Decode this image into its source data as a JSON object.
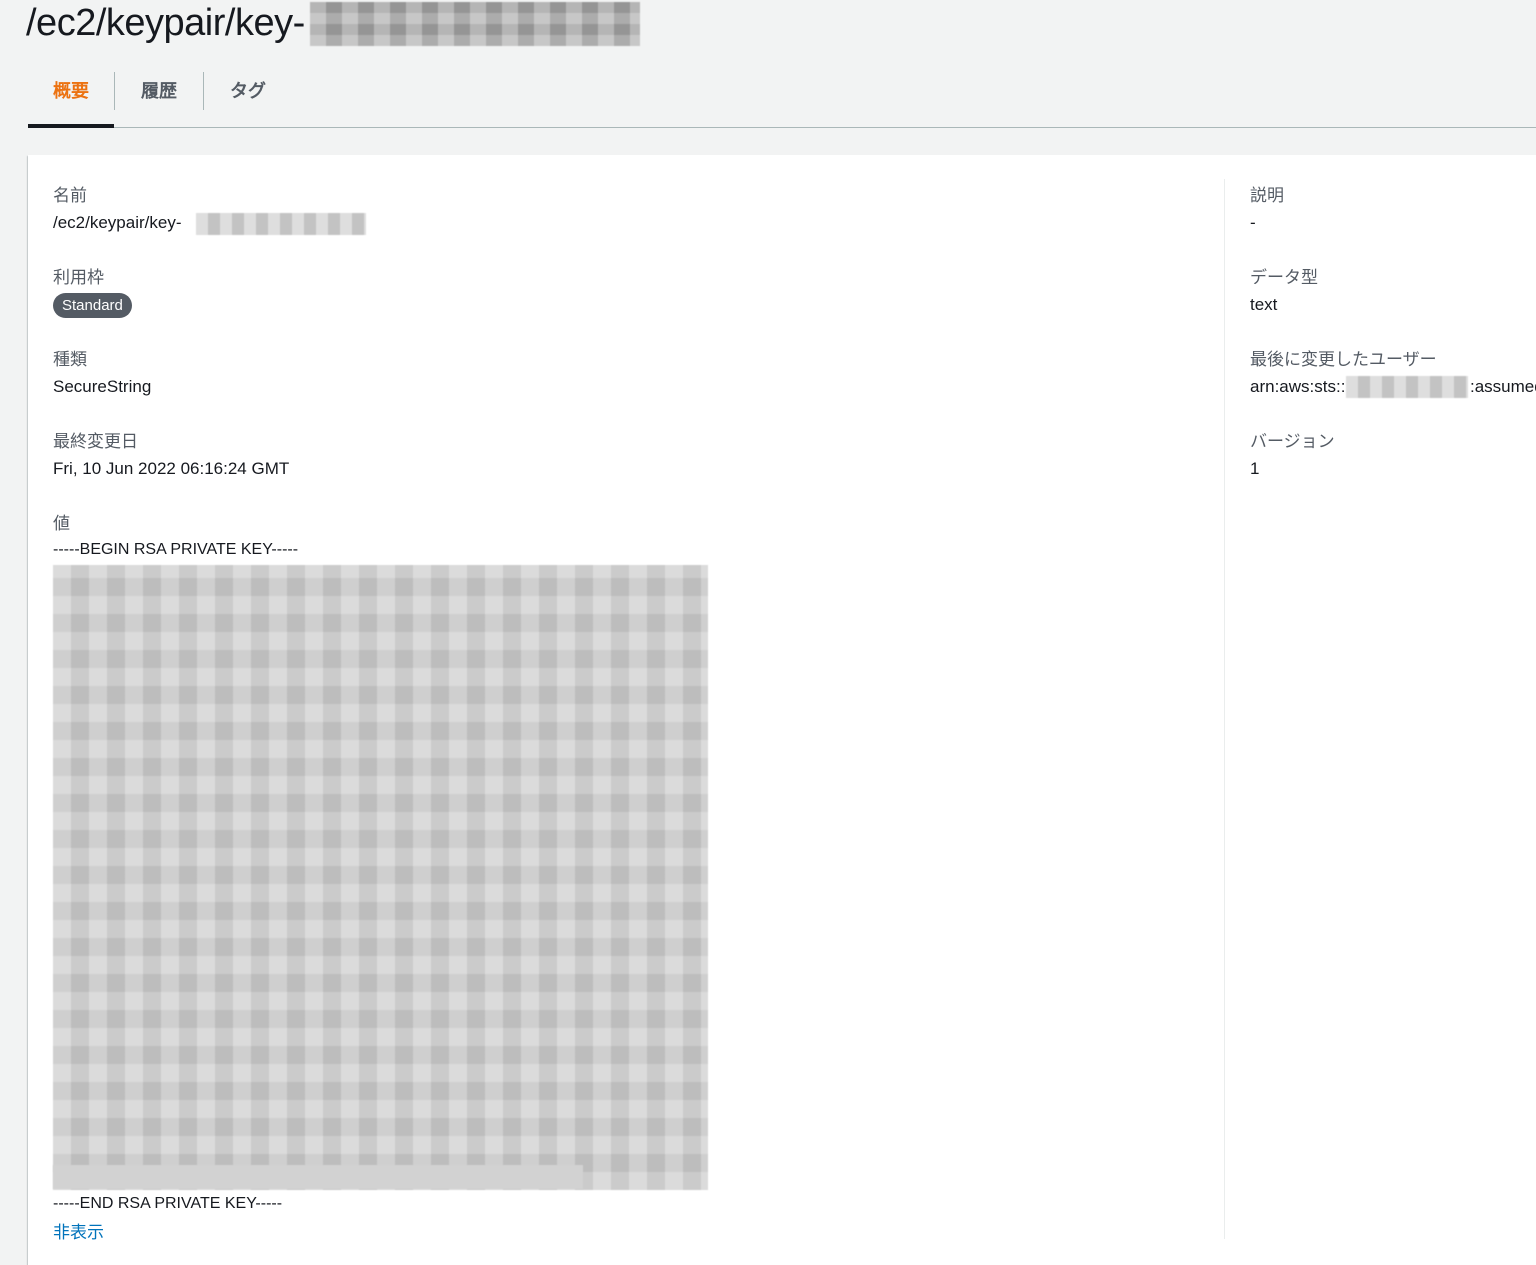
{
  "header": {
    "title": "/ec2/keypair/key-"
  },
  "tabs": [
    {
      "label": "概要",
      "active": true
    },
    {
      "label": "履歴",
      "active": false
    },
    {
      "label": "タグ",
      "active": false
    }
  ],
  "details": {
    "name_label": "名前",
    "name_value": "/ec2/keypair/key-",
    "tier_label": "利用枠",
    "tier_value": "Standard",
    "type_label": "種類",
    "type_value": "SecureString",
    "last_modified_label": "最終変更日",
    "last_modified_value": "Fri, 10 Jun 2022 06:16:24 GMT",
    "value_label": "値",
    "value_begin": "-----BEGIN RSA PRIVATE KEY-----",
    "value_end": "-----END RSA PRIVATE KEY-----",
    "hide_link": "非表示",
    "description_label": "説明",
    "description_value": "-",
    "data_type_label": "データ型",
    "data_type_value": "text",
    "last_modified_user_label": "最後に変更したユーザー",
    "last_modified_user_prefix": "arn:aws:sts::",
    "last_modified_user_suffix": ":assumed",
    "version_label": "バージョン",
    "version_value": "1"
  },
  "colors": {
    "accent_tab": "#ec7211",
    "link": "#0073bb",
    "badge_bg": "#545b64"
  }
}
